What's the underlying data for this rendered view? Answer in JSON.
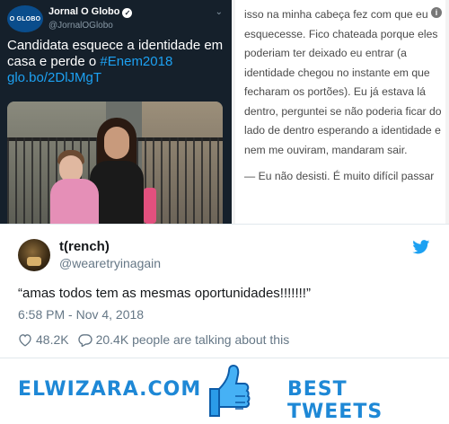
{
  "left_tweet": {
    "logo_text": "O GLOBO",
    "name": "Jornal O Globo",
    "handle": "@JornalOGlobo",
    "text_main": "Candidata esquece a identidade em casa e perde o ",
    "hashtag": "#Enem2018",
    "link": "glo.bo/2DlJMgT",
    "verified_icon": "verified-check-icon",
    "menu_icon": "chevron-down-icon"
  },
  "article": {
    "paragraph_1": "isso na minha cabeça fez com que eu esquecesse. Fico chateada porque eles poderiam ter deixado eu entrar (a identidade chegou no instante em que fecharam os portões). Eu já estava lá dentro, perguntei se não poderia ficar do lado de dentro esperando a identidade e nem me ouviram, mandaram sair.",
    "paragraph_2": "— Eu não desisti. É muito difícil passar",
    "info_icon_glyph": "i"
  },
  "tweet": {
    "user_name": "t(rench)",
    "user_handle": "@wearetryinagain",
    "text": "“amas todos tem as mesmas oportunidades!!!!!!!”",
    "timestamp": "6:58 PM - Nov 4, 2018",
    "likes": "48.2K",
    "talking": "20.4K people are talking about this",
    "brand_color": "#1da1f2"
  },
  "footer": {
    "left_brand": "ELWIZARA.COM",
    "right_brand": "BEST TWEETS",
    "accent_color": "#1e88d6"
  }
}
